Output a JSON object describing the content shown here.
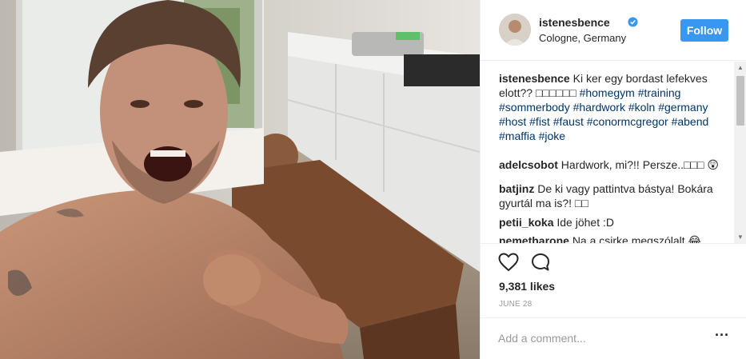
{
  "header": {
    "username": "istenesbence",
    "verified_icon": "verified-badge-icon",
    "location": "Cologne, Germany",
    "follow_label": "Follow"
  },
  "caption": {
    "username": "istenesbence",
    "text": "Ki ker egy bordast lefekves elott?? □□□□□□",
    "tags": [
      "#homegym",
      "#training",
      "#sommerbody",
      "#hardwork",
      "#koln",
      "#germany",
      "#host",
      "#fist",
      "#faust",
      "#conormcgregor",
      "#abend",
      "#maffia",
      "#joke"
    ]
  },
  "comments": [
    {
      "username": "adelcsobot",
      "text": "Hardwork, mi?!! Persze..□□□ 😲"
    },
    {
      "username": "batjinz",
      "text": "De ki vagy pattintva bástya! Bokára gyurtál ma is?! □□"
    },
    {
      "username": "petii_koka",
      "text": "Ide jöhet :D"
    },
    {
      "username": "nemetharone",
      "text": "Na a csirke megszólalt 😂"
    }
  ],
  "actions": {
    "like_icon": "heart-icon",
    "comment_icon": "comment-bubble-icon",
    "likes_text": "9,381 likes",
    "date": "JUNE 28"
  },
  "add_comment": {
    "placeholder": "Add a comment...",
    "more_icon": "more-options-icon"
  },
  "colors": {
    "follow_blue": "#3897f0",
    "hashtag": "#003569",
    "muted": "#999999"
  }
}
